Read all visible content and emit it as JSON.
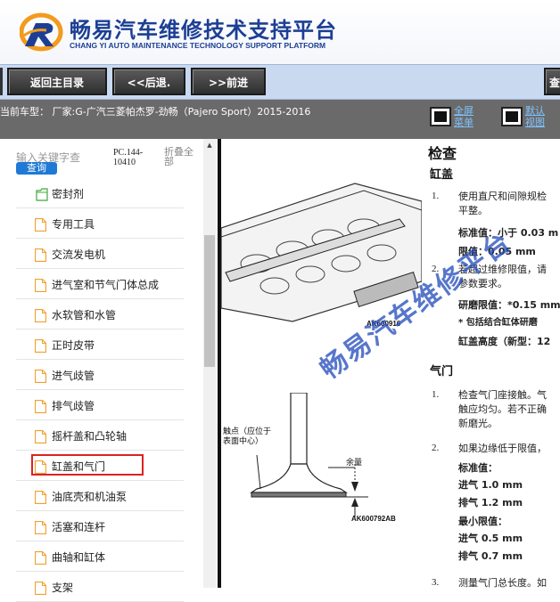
{
  "header": {
    "title": "畅易汽车维修技术支持平台",
    "subtitle": "CHANG YI AUTO MAINTENANCE TECHNOLOGY SUPPORT PLATFORM"
  },
  "toolbar": {
    "home_label": "返回主目录",
    "back_label": "<<后退.",
    "forward_label": ">>前进",
    "right_label": "查"
  },
  "infobar": {
    "car_text": "当前车型： 厂家:G-广汽三菱帕杰罗-劲畅（Pajero Sport）2015-2016",
    "fullscreen_label_1": "全屏",
    "fullscreen_label_2": "菜单",
    "default_label_1": "默认",
    "default_label_2": "视图"
  },
  "sidebar": {
    "search_placeholder": "输入关键字查",
    "search_button": "查询",
    "pc_ref_1": "PC.144-",
    "pc_ref_2": "10410",
    "collapse_1": "折叠全",
    "collapse_2": "部",
    "items": [
      {
        "label": "密封剂",
        "icon": "folder-icon"
      },
      {
        "label": "专用工具",
        "icon": "document-icon"
      },
      {
        "label": "交流发电机",
        "icon": "document-icon"
      },
      {
        "label": "进气室和节气门体总成",
        "icon": "document-icon"
      },
      {
        "label": "水软管和水管",
        "icon": "document-icon"
      },
      {
        "label": "正时皮带",
        "icon": "document-icon"
      },
      {
        "label": "进气歧管",
        "icon": "document-icon"
      },
      {
        "label": "排气歧管",
        "icon": "document-icon"
      },
      {
        "label": "摇杆盖和凸轮轴",
        "icon": "document-icon"
      },
      {
        "label": "缸盖和气门",
        "icon": "document-icon"
      },
      {
        "label": "油底壳和机油泵",
        "icon": "document-icon"
      },
      {
        "label": "活塞和连杆",
        "icon": "document-icon"
      },
      {
        "label": "曲轴和缸体",
        "icon": "document-icon"
      },
      {
        "label": "支架",
        "icon": "document-icon"
      }
    ]
  },
  "document": {
    "heading": "检查",
    "subheading": "缸盖",
    "step1_num": "1.",
    "step1_line1": "使用直尺和间隙规检",
    "step1_line2": "平整。",
    "standard_value": "标准值：小于 0.03 m",
    "limit_value": "限值：0.05 mm",
    "step2_num": "2.",
    "step2_line1": "若超过维修限值，请",
    "step2_line2": "参数要求。",
    "grind_limit": "研磨限值：*0.15 mm",
    "grind_note": "* 包括结合缸体研磨",
    "cyl_height": "缸盖高度（新型：12",
    "valve_heading": "气门",
    "step3_num": "1.",
    "step3_line1": "检查气门座接触。气",
    "step3_line2": "触应均匀。若不正确",
    "step3_line3": "新磨光。",
    "step4_num": "2.",
    "step4_line1": "如果边缘低于限值，",
    "std_label": "标准值：",
    "intake_std": "进气 1.0 mm",
    "exhaust_std": "排气 1.2 mm",
    "min_label": "最小限值：",
    "intake_min": "进气 0.5 mm",
    "exhaust_min": "排气 0.7 mm",
    "step5_num": "3.",
    "step5_line1": "测量气门总长度。如",
    "fig1_caption": "AK600916",
    "fig2_caption": "AK600792AB",
    "fig2_label_1": "触点（应位于",
    "fig2_label_2": "表面中心）",
    "fig2_margin": "余量",
    "watermark": "畅易汽车维修平台"
  }
}
